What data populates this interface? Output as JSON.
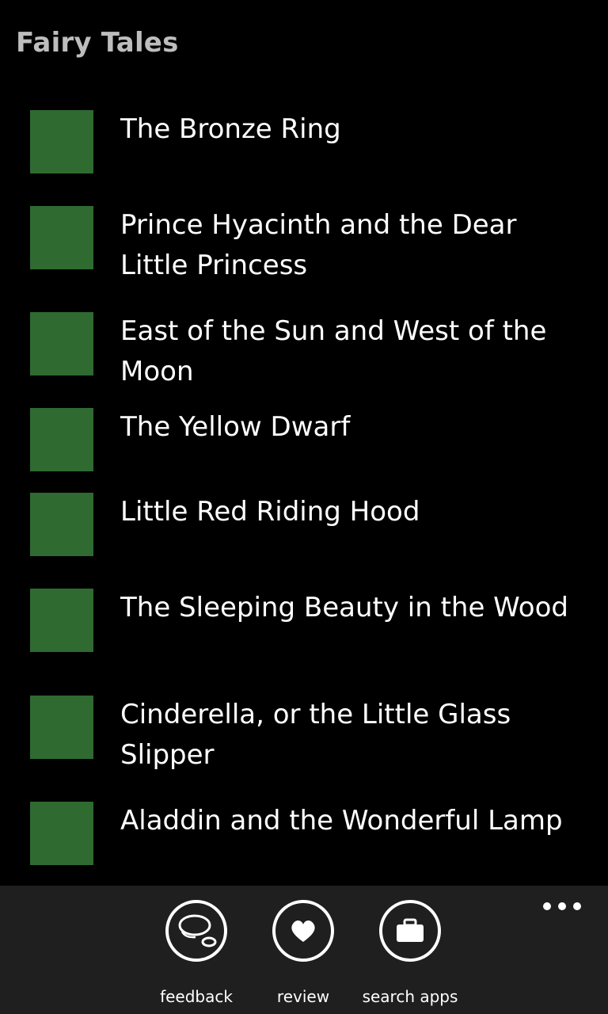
{
  "app": {
    "title": "Fairy Tales",
    "tile_color": "#2f6a31",
    "background": "#000000"
  },
  "tales": [
    {
      "title": "The Bronze Ring"
    },
    {
      "title": "Prince Hyacinth and the Dear Little Princess"
    },
    {
      "title": "East of the Sun and West of the Moon"
    },
    {
      "title": "The Yellow Dwarf"
    },
    {
      "title": "Little Red Riding Hood"
    },
    {
      "title": "The Sleeping Beauty in the Wood"
    },
    {
      "title": "Cinderella, or the Little Glass Slipper"
    },
    {
      "title": "Aladdin and the Wonderful Lamp"
    }
  ],
  "app_bar": {
    "buttons": [
      {
        "label": "feedback",
        "icon": "chat-bubble-icon"
      },
      {
        "label": "review",
        "icon": "heart-icon"
      },
      {
        "label": "search apps",
        "icon": "briefcase-icon"
      }
    ],
    "more_icon": "ellipsis-icon"
  }
}
